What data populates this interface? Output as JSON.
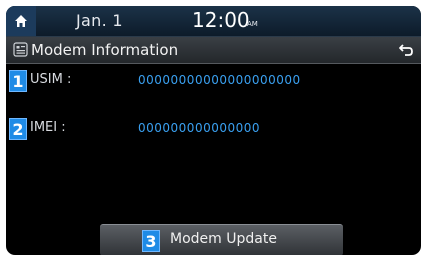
{
  "status_bar": {
    "date": "Jan.  1",
    "time": "12:00",
    "ampm": "AM"
  },
  "title_bar": {
    "title": "Modem Information"
  },
  "rows": [
    {
      "number": "1",
      "label": "USIM :",
      "value": "00000000000000000000"
    },
    {
      "number": "2",
      "label": "IMEI :",
      "value": "000000000000000"
    }
  ],
  "modem_update": {
    "number": "3",
    "label": "Modem Update"
  },
  "colors": {
    "badge": "#1f8be6",
    "value_text": "#3aa0f0",
    "status_bar": "#0d1b2a"
  },
  "icons": {
    "home": "home-icon",
    "title": "modem-info-icon",
    "back": "back-arrow-icon"
  }
}
